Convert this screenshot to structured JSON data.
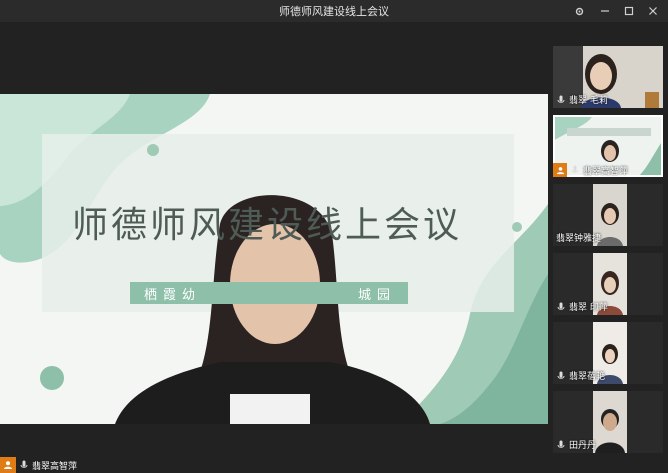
{
  "window": {
    "title": "师德师风建设线上会议",
    "controls": [
      "settings",
      "minimize",
      "maximize",
      "close"
    ]
  },
  "slide": {
    "title": "师德师风建设线上会议",
    "school_left": "栖霞幼",
    "school_right": "城园"
  },
  "self_view": {
    "name": "翡翠高智萍"
  },
  "participants": [
    {
      "name": "翡翠 毛莉",
      "mic": "on"
    },
    {
      "name": "翡翠高智萍",
      "mic": "on",
      "host": true,
      "content": "slide"
    },
    {
      "name": "翡翠钟雅捷",
      "mic": "off"
    },
    {
      "name": "翡翠 印萍",
      "mic": "on"
    },
    {
      "name": "翡翠蓓艳",
      "mic": "on"
    },
    {
      "name": "田丹丹",
      "mic": "on"
    }
  ],
  "colors": {
    "host_badge": "#e07c16",
    "slide_accent": "#8dbfa9",
    "window_bg": "#222222"
  }
}
